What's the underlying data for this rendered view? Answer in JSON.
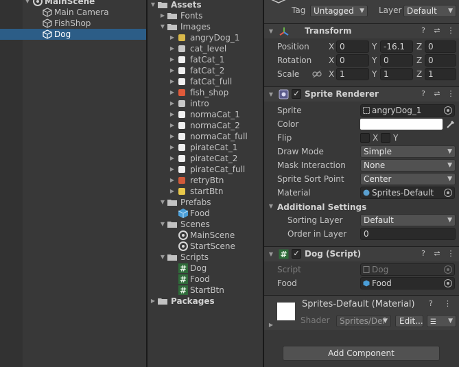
{
  "hierarchy": {
    "scene": "MainScene",
    "items": [
      {
        "label": "Main Camera"
      },
      {
        "label": "FishShop"
      },
      {
        "label": "Dog"
      }
    ]
  },
  "project": {
    "root": "Assets",
    "fonts": "Fonts",
    "images": "Images",
    "image_items": [
      "angryDog_1",
      "cat_level",
      "fatCat_1",
      "fatCat_2",
      "fatCat_full",
      "fish_shop",
      "intro",
      "normaCat_1",
      "normaCat_2",
      "normaCat_full",
      "pirateCat_1",
      "pirateCat_2",
      "pirateCat_full",
      "retryBtn",
      "startBtn"
    ],
    "prefabs": "Prefabs",
    "prefab_items": [
      "Food"
    ],
    "scenes": "Scenes",
    "scene_items": [
      "MainScene",
      "StartScene"
    ],
    "scripts": "Scripts",
    "script_items": [
      "Dog",
      "Food",
      "StartBtn"
    ],
    "packages": "Packages"
  },
  "inspector": {
    "tag_label": "Tag",
    "tag_value": "Untagged",
    "layer_label": "Layer",
    "layer_value": "Default",
    "transform": {
      "title": "Transform",
      "position_label": "Position",
      "rotation_label": "Rotation",
      "scale_label": "Scale",
      "position": {
        "x": "0",
        "y": "-16.1",
        "z": "0"
      },
      "rotation": {
        "x": "0",
        "y": "0",
        "z": "0"
      },
      "scale": {
        "x": "1",
        "y": "1",
        "z": "1"
      },
      "axis_x": "X",
      "axis_y": "Y",
      "axis_z": "Z"
    },
    "sprite_renderer": {
      "title": "Sprite Renderer",
      "sprite_label": "Sprite",
      "sprite_value": "angryDog_1",
      "color_label": "Color",
      "flip_label": "Flip",
      "flip_x": "X",
      "flip_y": "Y",
      "draw_mode_label": "Draw Mode",
      "draw_mode_value": "Simple",
      "mask_label": "Mask Interaction",
      "mask_value": "None",
      "sort_point_label": "Sprite Sort Point",
      "sort_point_value": "Center",
      "material_label": "Material",
      "material_value": "Sprites-Default",
      "additional_label": "Additional Settings",
      "sorting_layer_label": "Sorting Layer",
      "sorting_layer_value": "Default",
      "order_label": "Order in Layer",
      "order_value": "0"
    },
    "dog_script": {
      "title": "Dog (Script)",
      "script_label": "Script",
      "script_value": "Dog",
      "food_label": "Food",
      "food_value": "Food"
    },
    "material": {
      "title": "Sprites-Default (Material)",
      "shader_label": "Shader",
      "shader_value": "Sprites/Def",
      "edit_label": "Edit..."
    },
    "add_component": "Add Component"
  }
}
